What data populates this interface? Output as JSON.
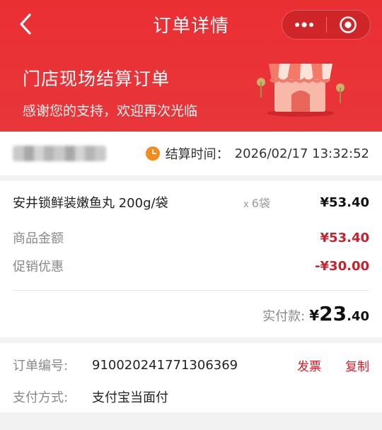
{
  "nav": {
    "title": "订单详情"
  },
  "hero": {
    "title": "门店现场结算订单",
    "subtitle": "感谢您的支持，欢迎再次光临"
  },
  "time": {
    "label": "结算时间：",
    "value": "2026/02/17 13:32:52"
  },
  "items": [
    {
      "name": "安井锁鲜装嫩鱼丸 200g/袋",
      "qty_prefix": "x",
      "qty": "6袋",
      "price": "¥53.40"
    }
  ],
  "summary": {
    "goods_label": "商品金额",
    "goods_value": "¥53.40",
    "promo_label": "促销优惠",
    "promo_value": "-¥30.00",
    "paid_label": "实付款:",
    "paid_yen": "¥",
    "paid_int": "23",
    "paid_dec": ".40"
  },
  "order": {
    "id_label": "订单编号:",
    "id_value": "910020241771306369",
    "invoice_label": "发票",
    "copy_label": "复制",
    "pay_label": "支付方式:",
    "pay_value": "支付宝当面付"
  },
  "colors": {
    "brand_red": "#e8363a",
    "price_red": "#c8202d",
    "clock_orange": "#f58a1f"
  },
  "icons": [
    "back-arrow-icon",
    "more-dots-icon",
    "mini-program-close-icon",
    "shop-illustration",
    "clock-icon"
  ]
}
